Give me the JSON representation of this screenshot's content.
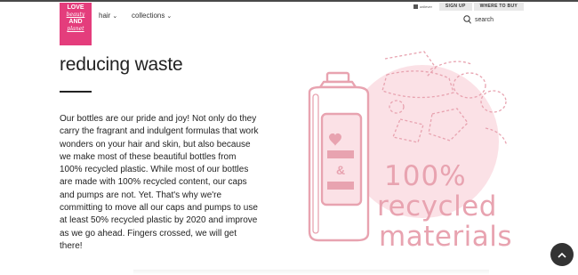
{
  "header": {
    "logo": {
      "line1": "LOVE",
      "line2": "beauty",
      "line3": "AND",
      "line4": "planet"
    },
    "nav": [
      {
        "label": "hair"
      },
      {
        "label": "collections"
      }
    ],
    "utility": {
      "brand_text": "unilever",
      "sign_up": "SIGN UP",
      "where_to_buy": "WHERE TO BUY"
    },
    "search": {
      "label": "search"
    }
  },
  "main": {
    "title": "reducing waste",
    "paragraph": "Our bottles are our pride and joy! Not only do they carry the fragrant and indulgent formulas that work wonders on your hair and skin, but also because we make most of these beautiful bottles from 100% recycled plastic. While most of our bottles are made with 100% recycled content, our caps and pumps are not. Yet. That's why we're committing to move all our caps and pumps to use at least 50% recycled plastic by 2020 and improve as we go ahead. Fingers crossed, we will get there!"
  },
  "illustration": {
    "line1": "100%",
    "line2": "recycled",
    "line3": "materials",
    "label_symbol": "&"
  },
  "colors": {
    "brand_pink": "#e43d7c",
    "illustration_pink": "#e8a3b0",
    "circle_pink": "#fbe1e6"
  }
}
